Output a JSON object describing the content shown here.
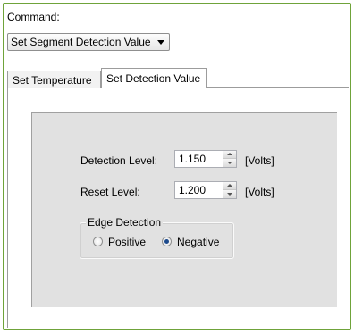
{
  "command": {
    "label": "Command:",
    "selected": "Set Segment Detection Value"
  },
  "tabs": [
    {
      "label": "Set Temperature",
      "active": false
    },
    {
      "label": "Set Detection Value",
      "active": true
    }
  ],
  "detection": {
    "label": "Detection Level:",
    "value": "1.150",
    "unit": "[Volts]"
  },
  "reset": {
    "label": "Reset Level:",
    "value": "1.200",
    "unit": "[Volts]"
  },
  "edge": {
    "title": "Edge Detection",
    "options": [
      {
        "label": "Positive",
        "checked": false
      },
      {
        "label": "Negative",
        "checked": true
      }
    ]
  },
  "colors": {
    "frame_border": "#6fa33a",
    "group_bg": "#e1e1e1",
    "radio_dot": "#1c4a8c"
  }
}
